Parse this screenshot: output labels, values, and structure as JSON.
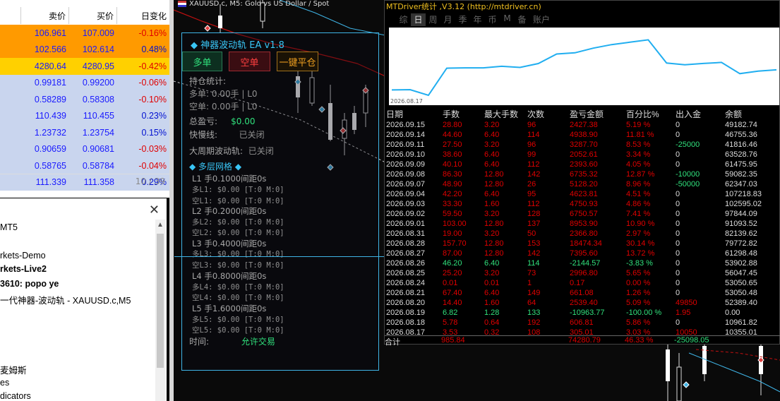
{
  "market_watch": {
    "headers": {
      "ask": "卖价",
      "bid": "买价",
      "change": "日变化"
    },
    "rows": [
      {
        "bid": "106.961",
        "ask": "107.009",
        "change": "-0.16%",
        "color": "orange",
        "neg": true
      },
      {
        "bid": "102.566",
        "ask": "102.614",
        "change": "0.48%",
        "color": "orange",
        "neg": false
      },
      {
        "bid": "4280.64",
        "ask": "4280.95",
        "change": "-0.42%",
        "color": "gold",
        "neg": true
      },
      {
        "bid": "0.99181",
        "ask": "0.99200",
        "change": "-0.06%",
        "color": "blue",
        "neg": true
      },
      {
        "bid": "0.58289",
        "ask": "0.58308",
        "change": "-0.10%",
        "color": "blue",
        "neg": true
      },
      {
        "bid": "110.439",
        "ask": "110.455",
        "change": "0.23%",
        "color": "blue",
        "neg": false
      },
      {
        "bid": "1.23732",
        "ask": "1.23754",
        "change": "0.15%",
        "color": "blue",
        "neg": false
      },
      {
        "bid": "0.90659",
        "ask": "0.90681",
        "change": "-0.03%",
        "color": "blue",
        "neg": true
      },
      {
        "bid": "0.58765",
        "ask": "0.58784",
        "change": "-0.04%",
        "color": "blue",
        "neg": true
      },
      {
        "bid": "111.339",
        "ask": "111.358",
        "change": "0.29%",
        "color": "blue",
        "neg": false
      }
    ],
    "pager": "10 / 39"
  },
  "navigator": {
    "items": [
      "MT5",
      "rkets-Demo",
      "rkets-Live2",
      "3610: popo ye",
      "一代神器-波动轨 - XAUUSD.c,M5",
      "麦姆斯",
      "es",
      "dicators"
    ]
  },
  "chart": {
    "title": "XAUUSD.c, M5:  Gold vs US Dollar / Spot"
  },
  "ea": {
    "title": "神器波动轨 EA v1.8",
    "buy": "多单",
    "sell": "空单",
    "close_all": "一键平仓",
    "stats_label": "持仓统计:",
    "long_line": "多单: 0.00手 | L0",
    "short_line": "空单: 0.00手 | L0",
    "profit_label": "总盈亏:",
    "profit_value": "$0.00",
    "fast_label": "快慢线:",
    "fast_value": "已关闭",
    "big_label": "大周期波动轨:",
    "big_value": "已关闭",
    "grid_title": "◆ 多层网格 ◆",
    "levels": [
      {
        "head": "L1 手0.1000间距0s",
        "long": "多L1: $0.00 [T:0 M:0]",
        "short": "空L1: $0.00 [T:0 M:0]"
      },
      {
        "head": "L2 手0.2000间距0s",
        "long": "多L2: $0.00 [T:0 M:0]",
        "short": "空L2: $0.00 [T:0 M:0]"
      },
      {
        "head": "L3 手0.4000间距0s",
        "long": "多L3: $0.00 [T:0 M:0]",
        "short": "空L3: $0.00 [T:0 M:0]"
      },
      {
        "head": "L4 手0.8000间距0s",
        "long": "多L4: $0.00 [T:0 M:0]",
        "short": "空L4: $0.00 [T:0 M:0]"
      },
      {
        "head": "L5 手1.6000间距0s",
        "long": "多L5: $0.00 [T:0 M:0]",
        "short": "空L5: $0.00 [T:0 M:0]"
      }
    ],
    "time_label": "时间:",
    "time_value": "允许交易"
  },
  "mtd": {
    "title": "MTDriver统计 ,V3.12 (http://mtdriver.cn)",
    "tabs": [
      "综",
      "日",
      "周",
      "月",
      "季",
      "年",
      "币",
      "M",
      "备",
      "账户"
    ],
    "active_tab": 1,
    "graph_date": "2026.08.17",
    "headers": [
      "日期",
      "手数",
      "最大手数",
      "次数",
      "盈亏金额",
      "百分比%",
      "出入金",
      "余额"
    ],
    "rows": [
      [
        "2026.09.15",
        "28.80",
        "3.20",
        "96",
        "2427.38",
        "5.19 %",
        "0",
        "49182.74"
      ],
      [
        "2026.09.14",
        "44.60",
        "6.40",
        "114",
        "4938.90",
        "11.81 %",
        "0",
        "46755.36"
      ],
      [
        "2026.09.11",
        "27.50",
        "3.20",
        "96",
        "3287.70",
        "8.53 %",
        "-25000",
        "41816.46"
      ],
      [
        "2026.09.10",
        "38.60",
        "6.40",
        "99",
        "2052.61",
        "3.34 %",
        "0",
        "63528.76"
      ],
      [
        "2026.09.09",
        "40.10",
        "6.40",
        "112",
        "2393.60",
        "4.05 %",
        "0",
        "61475.95"
      ],
      [
        "2026.09.08",
        "86.30",
        "12.80",
        "142",
        "6735.32",
        "12.87 %",
        "-10000",
        "59082.35"
      ],
      [
        "2026.09.07",
        "48.90",
        "12.80",
        "26",
        "5128.20",
        "8.96 %",
        "-50000",
        "62347.03"
      ],
      [
        "2026.09.04",
        "42.20",
        "6.40",
        "95",
        "4623.81",
        "4.51 %",
        "0",
        "107218.83"
      ],
      [
        "2026.09.03",
        "33.30",
        "1.60",
        "112",
        "4750.93",
        "4.86 %",
        "0",
        "102595.02"
      ],
      [
        "2026.09.02",
        "59.50",
        "3.20",
        "128",
        "6750.57",
        "7.41 %",
        "0",
        "97844.09"
      ],
      [
        "2026.09.01",
        "103.00",
        "12.80",
        "137",
        "8953.90",
        "10.90 %",
        "0",
        "91093.52"
      ],
      [
        "2026.08.31",
        "19.00",
        "3.20",
        "50",
        "2366.80",
        "2.97 %",
        "0",
        "82139.62"
      ],
      [
        "2026.08.28",
        "157.70",
        "12.80",
        "153",
        "18474.34",
        "30.14 %",
        "0",
        "79772.82"
      ],
      [
        "2026.08.27",
        "87.00",
        "12.80",
        "142",
        "7395.60",
        "13.72 %",
        "0",
        "61298.48"
      ],
      [
        "2026.08.26",
        "46.20",
        "6.40",
        "114",
        "-2144.57",
        "-3.83 %",
        "0",
        "53902.88"
      ],
      [
        "2026.08.25",
        "25.20",
        "3.20",
        "73",
        "2996.80",
        "5.65 %",
        "0",
        "56047.45"
      ],
      [
        "2026.08.24",
        "0.01",
        "0.01",
        "1",
        "0.17",
        "0.00 %",
        "0",
        "53050.65"
      ],
      [
        "2026.08.21",
        "67.40",
        "6.40",
        "149",
        "661.08",
        "1.26 %",
        "0",
        "53050.48"
      ],
      [
        "2026.08.20",
        "14.40",
        "1.60",
        "64",
        "2539.40",
        "5.09 %",
        "49850",
        "52389.40"
      ],
      [
        "2026.08.19",
        "6.82",
        "1.28",
        "133",
        "-10963.77",
        "-100.00 %",
        "1.95",
        "0.00"
      ],
      [
        "2026.08.18",
        "5.78",
        "0.64",
        "192",
        "606.81",
        "5.86 %",
        "0",
        "10961.82"
      ],
      [
        "2026.08.17",
        "3.53",
        "0.32",
        "108",
        "305.01",
        "3.03 %",
        "10050",
        "10355.01"
      ]
    ],
    "total": [
      "合计",
      "985.84",
      "",
      "",
      "74280.79",
      "46.33 %",
      "-25098.05",
      ""
    ],
    "balance_curve": [
      49182.74,
      46755.36,
      41816.46,
      63528.76,
      61475.95,
      59082.35,
      62347.03,
      107218.83,
      102595.02,
      97844.09,
      91093.52,
      82139.62,
      79772.82,
      61298.48,
      53902.88,
      56047.45,
      53050.65,
      53050.48,
      52389.4,
      0.0,
      10961.82,
      10355.01
    ]
  }
}
